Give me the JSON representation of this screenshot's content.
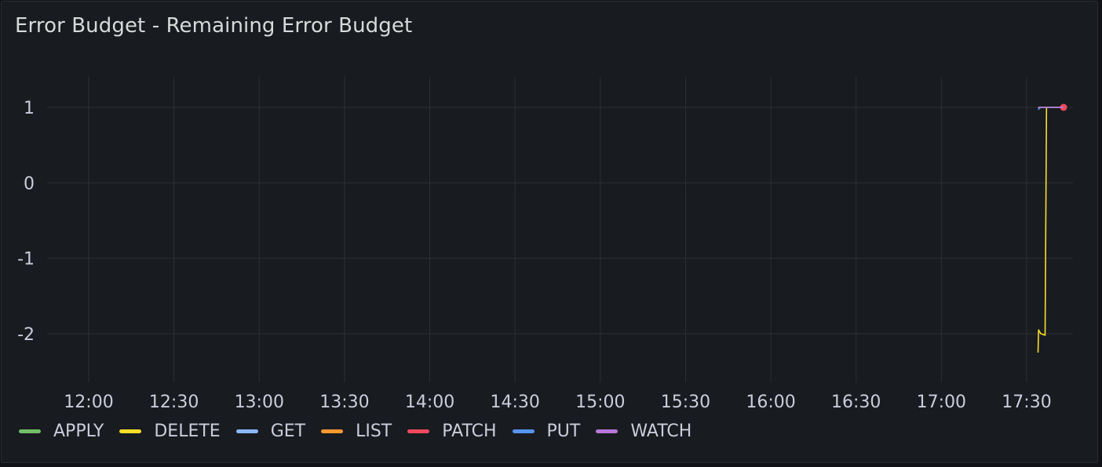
{
  "panel": {
    "title": "Error Budget - Remaining Error Budget"
  },
  "chart_data": {
    "type": "line",
    "title": "Error Budget - Remaining Error Budget",
    "xlabel": "",
    "ylabel": "",
    "x_ticks": [
      "12:00",
      "12:30",
      "13:00",
      "13:30",
      "14:00",
      "14:30",
      "15:00",
      "15:30",
      "16:00",
      "16:30",
      "17:00",
      "17:30"
    ],
    "y_ticks": [
      1,
      0,
      -1,
      -2
    ],
    "ylim": [
      -2.6,
      1.4
    ],
    "xlim": [
      "11:37",
      "17:51"
    ],
    "grid": true,
    "legend_position": "bottom-left",
    "series": [
      {
        "name": "APPLY",
        "color": "#73bf69",
        "points": []
      },
      {
        "name": "DELETE",
        "color": "#fade2a",
        "points": [
          [
            "17:34",
            -2.25
          ],
          [
            "17:34.2",
            -1.95
          ],
          [
            "17:35",
            -2.0
          ],
          [
            "17:36.5",
            -2.02
          ],
          [
            "17:37",
            1.0
          ],
          [
            "17:43",
            1.0
          ]
        ]
      },
      {
        "name": "GET",
        "color": "#8ab8ff",
        "points": [
          [
            "17:34",
            1.0
          ],
          [
            "17:43",
            1.0
          ]
        ]
      },
      {
        "name": "LIST",
        "color": "#ff9830",
        "points": [
          [
            "17:34",
            1.0
          ],
          [
            "17:43",
            1.0
          ]
        ]
      },
      {
        "name": "PATCH",
        "color": "#f2495c",
        "points": [
          [
            "17:43",
            1.0
          ]
        ]
      },
      {
        "name": "PUT",
        "color": "#5794f2",
        "points": [
          [
            "17:34",
            0.97
          ],
          [
            "17:35",
            1.0
          ],
          [
            "17:43",
            1.0
          ]
        ]
      },
      {
        "name": "WATCH",
        "color": "#b877d9",
        "points": [
          [
            "17:34",
            1.0
          ],
          [
            "17:43",
            1.0
          ]
        ]
      }
    ]
  }
}
